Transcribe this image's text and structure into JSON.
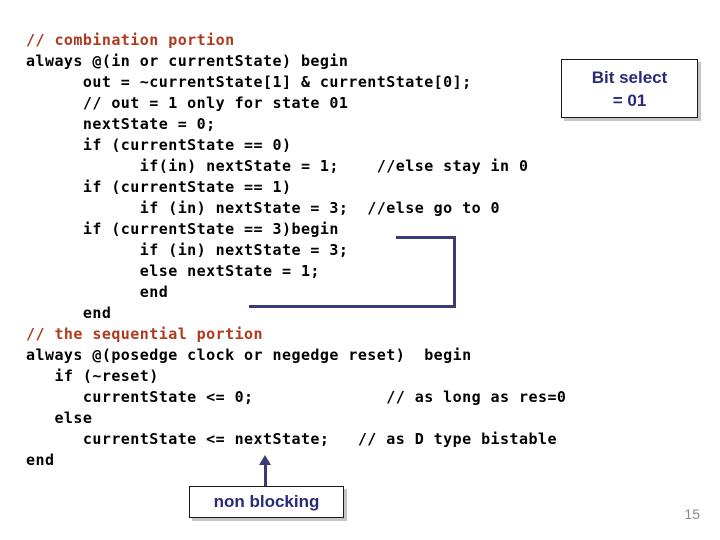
{
  "slide": {
    "page_number": "15",
    "accent_navy": "#3B3B7A",
    "comment_red": "#B03A1E",
    "code_black": "#000000"
  },
  "code": {
    "lines": [
      {
        "text": "// combination portion",
        "kind": "comment"
      },
      {
        "text": "always @(in or currentState) begin",
        "kind": "code"
      },
      {
        "text": "      out = ~currentState[1] & currentState[0];",
        "kind": "code"
      },
      {
        "text": "      // out = 1 only for state 01",
        "kind": "code"
      },
      {
        "text": "      nextState = 0;",
        "kind": "code"
      },
      {
        "text": "      if (currentState == 0)",
        "kind": "code"
      },
      {
        "text": "            if(in) nextState = 1;    //else stay in 0",
        "kind": "code"
      },
      {
        "text": "      if (currentState == 1)",
        "kind": "code"
      },
      {
        "text": "            if (in) nextState = 3;  //else go to 0",
        "kind": "code"
      },
      {
        "text": "      if (currentState == 3)begin",
        "kind": "code"
      },
      {
        "text": "            if (in) nextState = 3;",
        "kind": "code"
      },
      {
        "text": "            else nextState = 1;",
        "kind": "code"
      },
      {
        "text": "            end",
        "kind": "code"
      },
      {
        "text": "      end",
        "kind": "code"
      },
      {
        "text": "// the sequential portion",
        "kind": "comment"
      },
      {
        "text": "always @(posedge clock or negedge reset)  begin",
        "kind": "code"
      },
      {
        "text": "   if (~reset)",
        "kind": "code"
      },
      {
        "text": "      currentState <= 0;              // as long as res=0",
        "kind": "code"
      },
      {
        "text": "   else",
        "kind": "code"
      },
      {
        "text": "      currentState <= nextState;   // as D type bistable",
        "kind": "code"
      },
      {
        "text": "end",
        "kind": "code"
      }
    ]
  },
  "callouts": {
    "bit_select": {
      "line1": "Bit select",
      "line2": "= 01"
    },
    "non_blocking": {
      "label": "non blocking"
    }
  }
}
